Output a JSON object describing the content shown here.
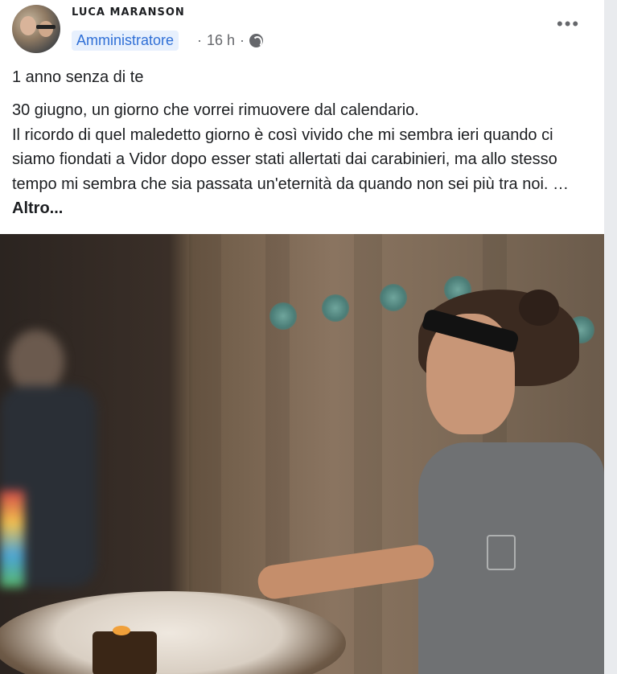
{
  "post": {
    "author": "LUCA MARANSON",
    "role_badge": "Amministratore",
    "time": "16 h",
    "separator": "·",
    "more_menu": "•••",
    "first_line": "1 anno senza di te",
    "body_lines": [
      "30 giugno, un giorno che vorrei rimuovere dal calendario.",
      "Il ricordo di quel maledetto giorno è così vivido che mi sembra ieri quando ci siamo fiondati a Vidor dopo esser stati allertati dai carabinieri, ma allo stesso tempo mi sembra che sia passata un'eternità da quando non sei più tra noi. … "
    ],
    "see_more": "Altro...",
    "privacy_icon": "globe-icon"
  }
}
